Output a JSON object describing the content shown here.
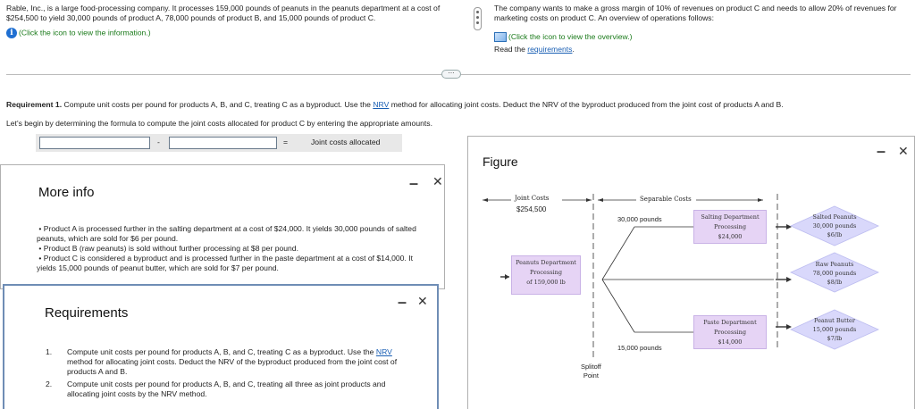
{
  "intro": {
    "left_text": "Rable, Inc., is a large food-processing company. It processes 159,000 pounds of peanuts in the peanuts department at a cost of $254,500 to yield 30,000 pounds of product A, 78,000 pounds of product B, and 15,000 pounds of product C.",
    "info_link": "(Click the icon to view the information.)",
    "right_text": "The company wants to make a gross margin of 10% of revenues on product C and needs to allow 20% of revenues for marketing costs on product C. An overview of operations follows:",
    "overview_link": "(Click the icon to view the overview.)",
    "read_prefix": "Read the ",
    "requirements_link": "requirements",
    "read_suffix": "."
  },
  "expand_button": "⋯",
  "question": {
    "req1_bold": "Requirement 1.",
    "req1_a": " Compute unit costs per pound for products A, B, and C, treating C as a byproduct. Use the ",
    "req1_nrv": "NRV",
    "req1_b": " method for allocating joint costs. Deduct the NRV of the byproduct produced from the joint cost of products A and B.",
    "instruction": "Let's begin by determining the formula to compute the joint costs allocated for product C by entering the appropriate amounts.",
    "minus_sign": "-",
    "equals_sign": "=",
    "result_label": "Joint costs allocated"
  },
  "more_info": {
    "title": "More info",
    "bullets": [
      "Product A is processed further in the salting department at a cost of $24,000. It yields 30,000 pounds of salted peanuts, which are sold for $6 per pound.",
      "Product B (raw peanuts) is sold without further processing at $8 per pound.",
      "Product C is considered a byproduct and is processed further in the paste department at a cost of $14,000. It yields 15,000 pounds of peanut butter, which are sold for $7 per pound."
    ]
  },
  "requirements_panel": {
    "title": "Requirements",
    "item1_num": "1.",
    "item1_a": "Compute unit costs per pound for products A, B, and C, treating C as a byproduct. Use the ",
    "item1_nrv": "NRV",
    "item1_b": " method for allocating joint costs. Deduct the NRV of the byproduct produced from the joint cost of products A and B.",
    "item2_num": "2.",
    "item2": "Compute unit costs per pound for products A, B, and C, treating all three as joint products and allocating joint costs by the NRV method."
  },
  "figure": {
    "title": "Figure",
    "joint_costs_label": "Joint Costs",
    "joint_costs_value": "$254,500",
    "separable_costs_label": "Separable Costs",
    "peanuts_dept": [
      "Peanuts Department",
      "Processing",
      "of 159,000 lb"
    ],
    "lb_30000": "30,000 pounds",
    "lb_15000": "15,000 pounds",
    "salting_dept": [
      "Salting Department",
      "Processing",
      "$24,000"
    ],
    "paste_dept": [
      "Paste Department",
      "Processing",
      "$14,000"
    ],
    "salted": [
      "Salted Peanuts",
      "30,000 pounds",
      "$6/lb"
    ],
    "raw": [
      "Raw Peanuts",
      "78,000 pounds",
      "$8/lb"
    ],
    "butter": [
      "Peanut Butter",
      "15,000 pounds",
      "$7/lb"
    ],
    "splitoff": [
      "Splitoff",
      "Point"
    ]
  },
  "controls": {
    "minimize": "–",
    "close": "✕"
  },
  "colors": {
    "lavender": "#e6d4f5",
    "link": "#1a5fb4",
    "info_blue": "#1f6fd1",
    "green": "#1a7a1a"
  }
}
